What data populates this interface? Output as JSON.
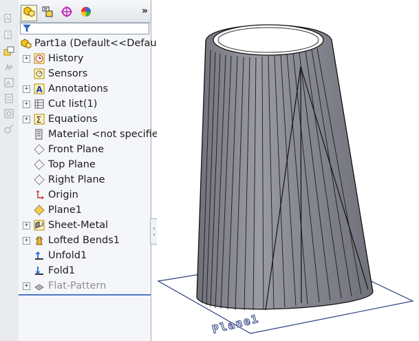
{
  "tabs": [
    {
      "name": "featuremanager-tab",
      "icon": "featuremanager-tree-icon"
    },
    {
      "name": "propertymanager-tab",
      "icon": "propertymanager-icon"
    },
    {
      "name": "configurationmanager-tab",
      "icon": "configuration-icon"
    },
    {
      "name": "displaymanager-tab",
      "icon": "display-pie-icon"
    }
  ],
  "tabbar": {
    "more": "»"
  },
  "tree": {
    "root": "Part1a  (Default<<Default",
    "items": [
      {
        "label": "History",
        "icon": "history-icon",
        "expandable": true
      },
      {
        "label": "Sensors",
        "icon": "sensors-icon",
        "expandable": false
      },
      {
        "label": "Annotations",
        "icon": "annotations-icon",
        "expandable": true
      },
      {
        "label": "Cut list(1)",
        "icon": "cut-list-icon",
        "expandable": true
      },
      {
        "label": "Equations",
        "icon": "equations-icon",
        "expandable": true
      },
      {
        "label": "Material <not specified",
        "icon": "material-icon",
        "expandable": false
      },
      {
        "label": "Front Plane",
        "icon": "plane-icon",
        "expandable": false
      },
      {
        "label": "Top Plane",
        "icon": "plane-icon",
        "expandable": false
      },
      {
        "label": "Right Plane",
        "icon": "plane-icon",
        "expandable": false
      },
      {
        "label": "Origin",
        "icon": "origin-icon",
        "expandable": false
      },
      {
        "label": "Plane1",
        "icon": "plane-yellow-icon",
        "expandable": false
      },
      {
        "label": "Sheet-Metal",
        "icon": "sheet-metal-icon",
        "expandable": true
      },
      {
        "label": "Lofted Bends1",
        "icon": "lofted-bends-icon",
        "expandable": true
      },
      {
        "label": "Unfold1",
        "icon": "unfold-icon",
        "expandable": false
      },
      {
        "label": "Fold1",
        "icon": "fold-icon",
        "expandable": false
      },
      {
        "label": "Flat-Pattern",
        "icon": "flat-pattern-icon",
        "expandable": true
      }
    ]
  },
  "viewport": {
    "plane_label": "Plane1"
  },
  "colors": {
    "panel_bg": "#f4f6f9",
    "rollback_bar": "#4a78c2",
    "model_gray": "#8e8f98"
  }
}
